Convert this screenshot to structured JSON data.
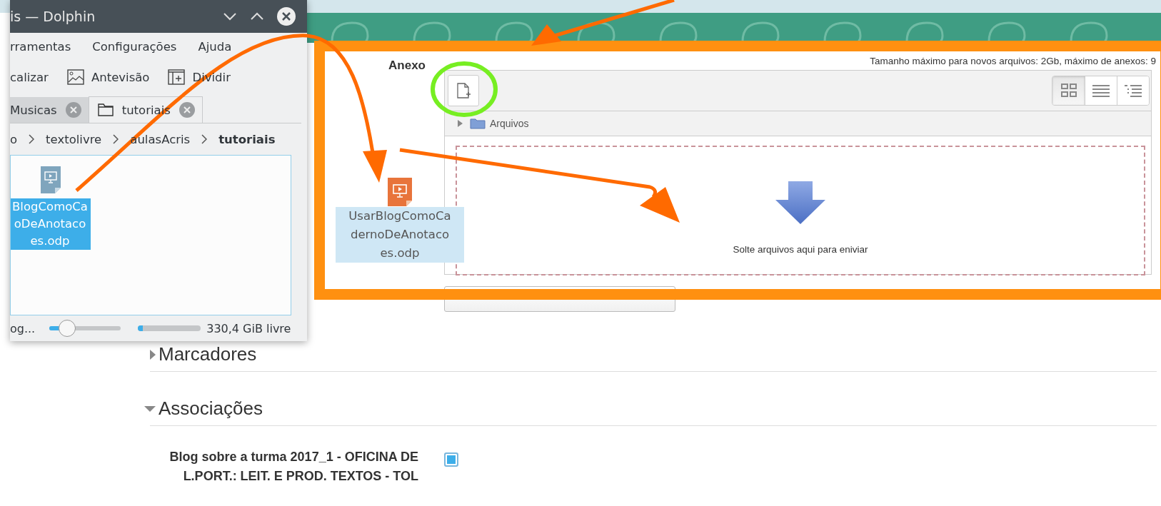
{
  "dolphin": {
    "title": "is — Dolphin",
    "menu": [
      "rramentas",
      "Configurações",
      "Ajuda"
    ],
    "toolbar": [
      {
        "label": "calizar",
        "kind": "text"
      },
      {
        "label": "Antevisão",
        "kind": "preview"
      },
      {
        "label": "Dividir",
        "kind": "split"
      }
    ],
    "tabs": [
      {
        "label": "Musicas",
        "selected": false
      },
      {
        "label": "tutoriais",
        "selected": true
      }
    ],
    "breadcrumb": [
      "o",
      "textolivre",
      "aulasAcris",
      "tutoriais"
    ],
    "file": {
      "name_lines": [
        "BlogComoCa",
        "oDeAnotaco",
        "es.odp"
      ],
      "selected": true
    },
    "status": {
      "text": "og...",
      "zoom": {
        "level": 0.2
      },
      "space": {
        "level": 0.08
      },
      "free": "330,4 GiB livre"
    }
  },
  "form": {
    "attachment": {
      "label": "Anexo",
      "limits": "Tamanho máximo para novos arquivos: 2Gb, máximo de anexos: 9",
      "folder": "Arquivos",
      "views": [
        {
          "kind": "icons",
          "selected": true
        },
        {
          "kind": "list",
          "selected": false
        },
        {
          "kind": "tree",
          "selected": false
        }
      ],
      "drop_text": "Solte arquivos aqui para eniviar"
    },
    "dragged_file": {
      "name_lines": [
        "UsarBlogComoCa",
        "dernoDeAnotaco",
        "es.odp"
      ]
    },
    "sections": [
      {
        "title": "Marcadores",
        "expanded": false
      },
      {
        "title": "Associações",
        "expanded": true
      }
    ],
    "association": {
      "label": "Blog sobre a turma 2017_1 - OFICINA DE L.PORT.: LEIT. E PROD. TEXTOS - TOL",
      "checked": true
    }
  }
}
